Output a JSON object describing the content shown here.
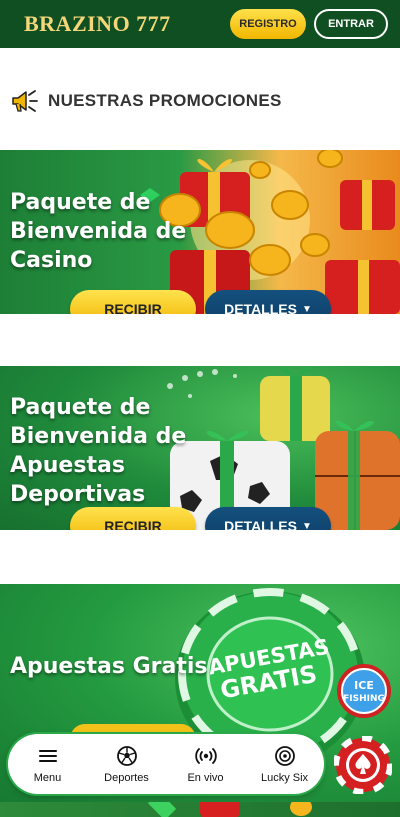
{
  "header": {
    "logo": "BRAZINO 777",
    "register_label": "REGISTRO",
    "login_label": "ENTRAR"
  },
  "promotions": {
    "title": "NUESTRAS PROMOCIONES",
    "banners": [
      {
        "title_lines": [
          "Paquete de",
          "Bienvenida de",
          "Casino"
        ],
        "receive_label": "RECIBIR",
        "details_label": "DETALLES",
        "art": "gift-boxes-coins"
      },
      {
        "title_lines": [
          "Paquete de",
          "Bienvenida de",
          "Apuestas",
          "Deportivas"
        ],
        "receive_label": "RECIBIR",
        "details_label": "DETALLES",
        "art": "sports-gifts"
      },
      {
        "title_lines": [
          "Apuestas Gratis"
        ],
        "chip_text": [
          "APUESTAS",
          "GRATIS"
        ],
        "art": "green-chip"
      }
    ]
  },
  "bottom_nav": {
    "items": [
      {
        "label": "Menu",
        "icon": "menu-icon"
      },
      {
        "label": "Deportes",
        "icon": "soccer-ball-icon"
      },
      {
        "label": "En vivo",
        "icon": "live-broadcast-icon"
      },
      {
        "label": "Lucky Six",
        "icon": "lucky-six-icon"
      }
    ]
  },
  "ice_fishing_badge": [
    "ICE",
    "FISHING"
  ],
  "colors": {
    "header_bg": "#0f4f22",
    "logo_gold": "#f5d77a",
    "accent_yellow": "#f2b600",
    "details_blue": "#0d3e66",
    "banner_green": "#1f8a3b"
  }
}
